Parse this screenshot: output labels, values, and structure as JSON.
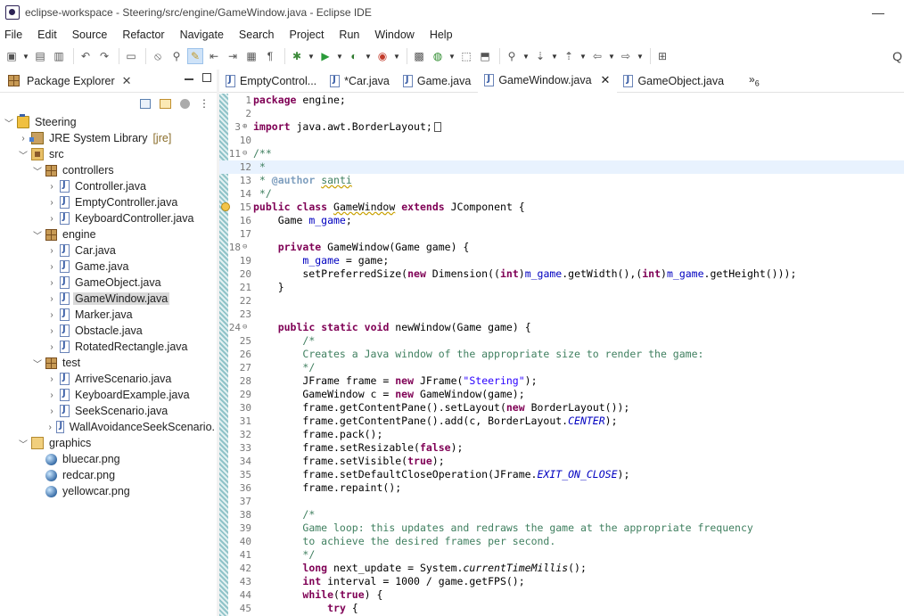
{
  "window": {
    "title": "eclipse-workspace - Steering/src/engine/GameWindow.java - Eclipse IDE",
    "minimize_glyph": "—"
  },
  "menu": [
    "File",
    "Edit",
    "Source",
    "Refactor",
    "Navigate",
    "Search",
    "Project",
    "Run",
    "Window",
    "Help"
  ],
  "toolbar": {
    "icons": [
      "new-icon",
      "save-icon",
      "save-all-icon",
      "undo-icon",
      "redo-icon",
      "terminal-icon",
      "skip-breakpoints-icon",
      "search-java-icon",
      "highlight-icon",
      "prev-annotation-icon",
      "next-annotation-icon",
      "toggle-mark-icon",
      "show-whitespace-icon",
      "debug-icon",
      "run-icon",
      "coverage-icon",
      "external-tools-icon",
      "new-java-project-icon",
      "new-class-icon",
      "open-type-icon",
      "open-task-icon",
      "search-icon",
      "next-edit-icon",
      "prev-edit-icon",
      "back-icon",
      "forward-icon",
      "perspective-icon"
    ],
    "search_glyph": "Q"
  },
  "explorer": {
    "tab_label": "Package Explorer",
    "close_glyph": "✕",
    "tree": [
      {
        "label": "Steering",
        "depth": 0,
        "twisty": "﹀",
        "icon": "project-icon",
        "iconClass": "i-project"
      },
      {
        "label": "JRE System Library",
        "annotation": "[jre]",
        "depth": 1,
        "twisty": "›",
        "icon": "library-icon",
        "iconClass": "i-lib"
      },
      {
        "label": "src",
        "depth": 1,
        "twisty": "﹀",
        "icon": "source-folder-icon",
        "iconClass": "i-src"
      },
      {
        "label": "controllers",
        "depth": 2,
        "twisty": "﹀",
        "icon": "package-icon",
        "iconClass": "i-pkg"
      },
      {
        "label": "Controller.java",
        "depth": 3,
        "twisty": "›",
        "icon": "java-file-icon",
        "iconClass": "i-java"
      },
      {
        "label": "EmptyController.java",
        "depth": 3,
        "twisty": "›",
        "icon": "java-file-icon",
        "iconClass": "i-java"
      },
      {
        "label": "KeyboardController.java",
        "depth": 3,
        "twisty": "›",
        "icon": "java-file-icon",
        "iconClass": "i-java"
      },
      {
        "label": "engine",
        "depth": 2,
        "twisty": "﹀",
        "icon": "package-icon",
        "iconClass": "i-pkg"
      },
      {
        "label": "Car.java",
        "depth": 3,
        "twisty": "›",
        "icon": "java-file-icon",
        "iconClass": "i-java"
      },
      {
        "label": "Game.java",
        "depth": 3,
        "twisty": "›",
        "icon": "java-file-icon",
        "iconClass": "i-java"
      },
      {
        "label": "GameObject.java",
        "depth": 3,
        "twisty": "›",
        "icon": "java-file-icon",
        "iconClass": "i-java"
      },
      {
        "label": "GameWindow.java",
        "depth": 3,
        "twisty": "›",
        "icon": "java-file-icon",
        "iconClass": "i-java",
        "selected": true
      },
      {
        "label": "Marker.java",
        "depth": 3,
        "twisty": "›",
        "icon": "java-file-icon",
        "iconClass": "i-java"
      },
      {
        "label": "Obstacle.java",
        "depth": 3,
        "twisty": "›",
        "icon": "java-file-icon",
        "iconClass": "i-java"
      },
      {
        "label": "RotatedRectangle.java",
        "depth": 3,
        "twisty": "›",
        "icon": "java-file-icon",
        "iconClass": "i-java"
      },
      {
        "label": "test",
        "depth": 2,
        "twisty": "﹀",
        "icon": "package-icon",
        "iconClass": "i-pkg"
      },
      {
        "label": "ArriveScenario.java",
        "depth": 3,
        "twisty": "›",
        "icon": "java-file-icon",
        "iconClass": "i-java"
      },
      {
        "label": "KeyboardExample.java",
        "depth": 3,
        "twisty": "›",
        "icon": "java-file-icon",
        "iconClass": "i-java"
      },
      {
        "label": "SeekScenario.java",
        "depth": 3,
        "twisty": "›",
        "icon": "java-file-icon",
        "iconClass": "i-java"
      },
      {
        "label": "WallAvoidanceSeekScenario.",
        "depth": 3,
        "twisty": "›",
        "icon": "java-file-icon",
        "iconClass": "i-java"
      },
      {
        "label": "graphics",
        "depth": 1,
        "twisty": "﹀",
        "icon": "folder-icon",
        "iconClass": "i-folder-open"
      },
      {
        "label": "bluecar.png",
        "depth": 2,
        "twisty": "",
        "icon": "image-file-icon",
        "iconClass": "i-png"
      },
      {
        "label": "redcar.png",
        "depth": 2,
        "twisty": "",
        "icon": "image-file-icon",
        "iconClass": "i-png"
      },
      {
        "label": "yellowcar.png",
        "depth": 2,
        "twisty": "",
        "icon": "image-file-icon",
        "iconClass": "i-png"
      }
    ]
  },
  "editor": {
    "tabs": [
      {
        "label": "EmptyControl...",
        "active": false
      },
      {
        "label": "*Car.java",
        "active": false
      },
      {
        "label": "Game.java",
        "active": false
      },
      {
        "label": "GameWindow.java",
        "active": true
      },
      {
        "label": "GameObject.java",
        "active": false
      }
    ],
    "more_tabs": "»",
    "more_count": "6",
    "close_glyph": "✕",
    "lines": [
      {
        "n": "1",
        "html": "<span class=\"kw\">package</span> engine;"
      },
      {
        "n": "2",
        "html": ""
      },
      {
        "n": "3",
        "fold": "⊕",
        "html": "<span class=\"kw\">import</span> java.awt.BorderLayout;<span class=\"box\"></span>"
      },
      {
        "n": "10",
        "html": ""
      },
      {
        "n": "11",
        "fold": "⊖",
        "html": "<span class=\"cm\">/**</span>"
      },
      {
        "n": "12",
        "hl": true,
        "html": "<span class=\"cm\"> *</span>"
      },
      {
        "n": "13",
        "html": "<span class=\"cm\"> * </span><span class=\"cmtag\">@author</span><span class=\"cm\"> <span class=\"ul\">santi</span></span>"
      },
      {
        "n": "14",
        "html": "<span class=\"cm\"> */</span>"
      },
      {
        "n": "15",
        "warn": true,
        "html": "<span class=\"kw\">public</span> <span class=\"kw\">class</span> <span class=\"ul\">GameWindow</span> <span class=\"kw\">extends</span> JComponent {"
      },
      {
        "n": "16",
        "html": "    Game <span class=\"fld\">m_game</span>;"
      },
      {
        "n": "17",
        "html": ""
      },
      {
        "n": "18",
        "fold": "⊖",
        "html": "    <span class=\"kw\">private</span> GameWindow(Game game) {"
      },
      {
        "n": "19",
        "html": "        <span class=\"fld\">m_game</span> = game;"
      },
      {
        "n": "20",
        "html": "        setPreferredSize(<span class=\"kw\">new</span> Dimension((<span class=\"kw\">int</span>)<span class=\"fld\">m_game</span>.getWidth(),(<span class=\"kw\">int</span>)<span class=\"fld\">m_game</span>.getHeight()));"
      },
      {
        "n": "21",
        "html": "    }"
      },
      {
        "n": "22",
        "html": ""
      },
      {
        "n": "23",
        "html": ""
      },
      {
        "n": "24",
        "fold": "⊖",
        "html": "    <span class=\"kw\">public</span> <span class=\"kw\">static</span> <span class=\"kw\">void</span> newWindow(Game game) {"
      },
      {
        "n": "25",
        "html": "        <span class=\"cm\">/*</span>"
      },
      {
        "n": "26",
        "html": "        <span class=\"cm\">Creates a Java window of the appropriate size to render the game:</span>"
      },
      {
        "n": "27",
        "html": "        <span class=\"cm\">*/</span>"
      },
      {
        "n": "28",
        "html": "        JFrame frame = <span class=\"kw\">new</span> JFrame(<span class=\"str\">\"Steering\"</span>);"
      },
      {
        "n": "29",
        "html": "        GameWindow c = <span class=\"kw\">new</span> GameWindow(game);"
      },
      {
        "n": "30",
        "html": "        frame.getContentPane().setLayout(<span class=\"kw\">new</span> BorderLayout());"
      },
      {
        "n": "31",
        "html": "        frame.getContentPane().add(c, BorderLayout.<span class=\"st\">CENTER</span>);"
      },
      {
        "n": "32",
        "html": "        frame.pack();"
      },
      {
        "n": "33",
        "html": "        frame.setResizable(<span class=\"kw\">false</span>);"
      },
      {
        "n": "34",
        "html": "        frame.setVisible(<span class=\"kw\">true</span>);"
      },
      {
        "n": "35",
        "html": "        frame.setDefaultCloseOperation(JFrame.<span class=\"st\">EXIT_ON_CLOSE</span>);"
      },
      {
        "n": "36",
        "html": "        frame.repaint();"
      },
      {
        "n": "37",
        "html": ""
      },
      {
        "n": "38",
        "html": "        <span class=\"cm\">/*</span>"
      },
      {
        "n": "39",
        "html": "        <span class=\"cm\">Game loop: this updates and redraws the game at the appropriate frequency</span>"
      },
      {
        "n": "40",
        "html": "        <span class=\"cm\">to achieve the desired frames per second.</span>"
      },
      {
        "n": "41",
        "html": "        <span class=\"cm\">*/</span>"
      },
      {
        "n": "42",
        "html": "        <span class=\"kw\">long</span> next_update = System.<span class=\"sm\">currentTimeMillis</span>();"
      },
      {
        "n": "43",
        "html": "        <span class=\"kw\">int</span> interval = 1000 / game.getFPS();"
      },
      {
        "n": "44",
        "html": "        <span class=\"kw\">while</span>(<span class=\"kw\">true</span>) {"
      },
      {
        "n": "45",
        "html": "            <span class=\"kw\">try</span> {"
      }
    ]
  }
}
